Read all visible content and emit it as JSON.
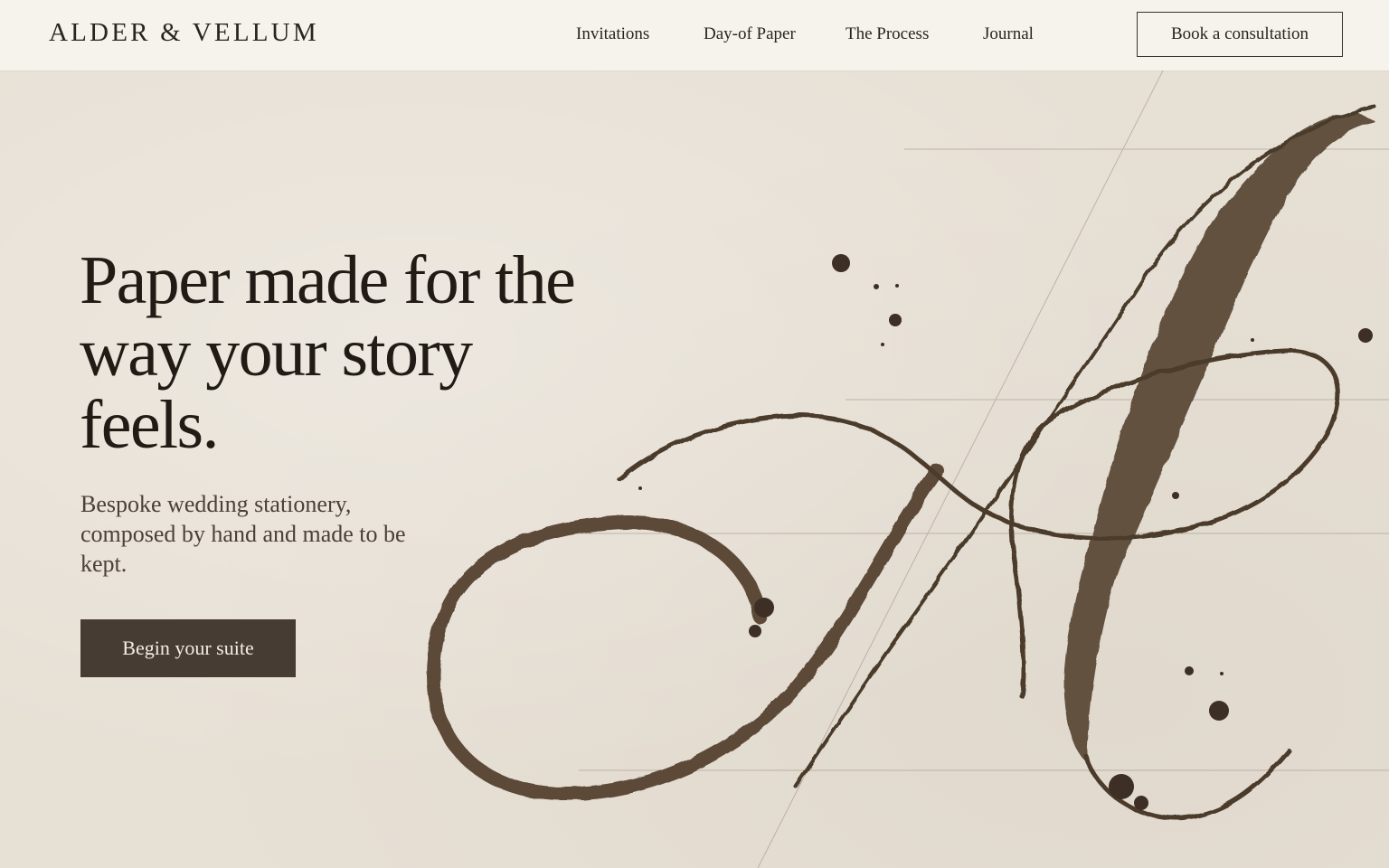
{
  "brand": {
    "name": "ALDER & VELLUM"
  },
  "nav": {
    "items": [
      {
        "label": "Invitations"
      },
      {
        "label": "Day-of Paper"
      },
      {
        "label": "The Process"
      },
      {
        "label": "Journal"
      }
    ],
    "cta_label": "Book a consultation"
  },
  "hero": {
    "title": "Paper made for the way your story feels.",
    "subtitle": "Bespoke wedding stationery, composed by hand and made to be kept.",
    "button_label": "Begin your suite"
  },
  "colors": {
    "paper": "#e7e0d5",
    "header": "#f6f2ec",
    "ink": "#2a221c",
    "button": "#473c33",
    "button_text": "#f3ede4"
  },
  "artwork": {
    "icon": "calligraphic-letter-a-illustration"
  }
}
